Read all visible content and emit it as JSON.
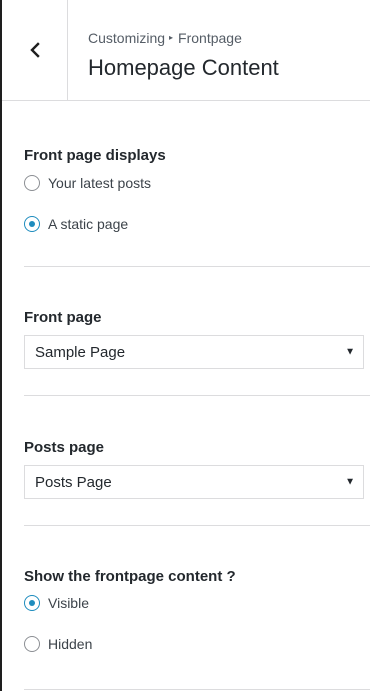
{
  "header": {
    "breadcrumb_root": "Customizing",
    "breadcrumb_separator": "▸",
    "breadcrumb_current": "Frontpage",
    "title": "Homepage Content"
  },
  "front_page_displays": {
    "title": "Front page displays",
    "options": [
      {
        "label": "Your latest posts",
        "selected": false
      },
      {
        "label": "A static page",
        "selected": true
      }
    ]
  },
  "front_page": {
    "title": "Front page",
    "selected": "Sample Page"
  },
  "posts_page": {
    "title": "Posts page",
    "selected": "Posts Page"
  },
  "frontpage_content": {
    "title": "Show the frontpage content ?",
    "options": [
      {
        "label": "Visible",
        "selected": true
      },
      {
        "label": "Hidden",
        "selected": false
      }
    ]
  },
  "colors": {
    "accent": "#1e8cbe",
    "border": "#dcdcde",
    "text": "#23282d"
  }
}
